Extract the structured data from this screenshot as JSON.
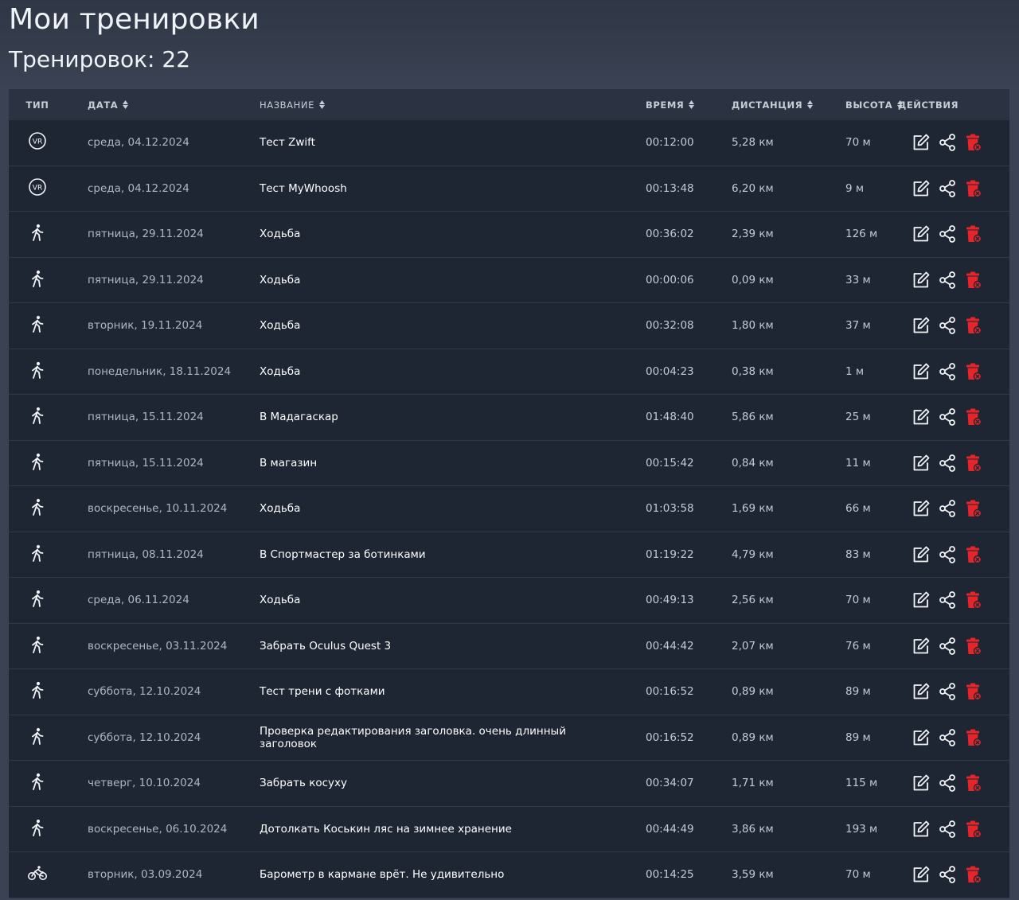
{
  "page": {
    "title": "Мои тренировки",
    "count_label": "Тренировок: 22"
  },
  "colors": {
    "delete": "#e5252a",
    "icon": "#f2f4f7"
  },
  "table": {
    "headers": {
      "type": "Тип",
      "date": "Дата",
      "name": "Название",
      "time": "Время",
      "distance": "Дистанция",
      "altitude": "Высота",
      "actions": "Действия"
    },
    "rows": [
      {
        "type": "vr-icon",
        "date": "среда, 04.12.2024",
        "name": "Тест Zwift",
        "time": "00:12:00",
        "distance": "5,28 км",
        "altitude": "70 м"
      },
      {
        "type": "vr-icon",
        "date": "среда, 04.12.2024",
        "name": "Тест MyWhoosh",
        "time": "00:13:48",
        "distance": "6,20 км",
        "altitude": "9 м"
      },
      {
        "type": "walk-icon",
        "date": "пятница, 29.11.2024",
        "name": "Ходьба",
        "time": "00:36:02",
        "distance": "2,39 км",
        "altitude": "126 м"
      },
      {
        "type": "walk-icon",
        "date": "пятница, 29.11.2024",
        "name": "Ходьба",
        "time": "00:00:06",
        "distance": "0,09 км",
        "altitude": "33 м"
      },
      {
        "type": "walk-icon",
        "date": "вторник, 19.11.2024",
        "name": "Ходьба",
        "time": "00:32:08",
        "distance": "1,80 км",
        "altitude": "37 м"
      },
      {
        "type": "walk-icon",
        "date": "понедельник, 18.11.2024",
        "name": "Ходьба",
        "time": "00:04:23",
        "distance": "0,38 км",
        "altitude": "1 м"
      },
      {
        "type": "walk-icon",
        "date": "пятница, 15.11.2024",
        "name": "В Мадагаскар",
        "time": "01:48:40",
        "distance": "5,86 км",
        "altitude": "25 м"
      },
      {
        "type": "walk-icon",
        "date": "пятница, 15.11.2024",
        "name": "В магазин",
        "time": "00:15:42",
        "distance": "0,84 км",
        "altitude": "11 м"
      },
      {
        "type": "walk-icon",
        "date": "воскресенье, 10.11.2024",
        "name": "Ходьба",
        "time": "01:03:58",
        "distance": "1,69 км",
        "altitude": "66 м"
      },
      {
        "type": "walk-icon",
        "date": "пятница, 08.11.2024",
        "name": "В Спортмастер за ботинками",
        "time": "01:19:22",
        "distance": "4,79 км",
        "altitude": "83 м"
      },
      {
        "type": "walk-icon",
        "date": "среда, 06.11.2024",
        "name": "Ходьба",
        "time": "00:49:13",
        "distance": "2,56 км",
        "altitude": "70 м"
      },
      {
        "type": "walk-icon",
        "date": "воскресенье, 03.11.2024",
        "name": "Забрать Oculus Quest 3",
        "time": "00:44:42",
        "distance": "2,07 км",
        "altitude": "76 м"
      },
      {
        "type": "walk-icon",
        "date": "суббота, 12.10.2024",
        "name": "Тест трени с фотками",
        "time": "00:16:52",
        "distance": "0,89 км",
        "altitude": "89 м"
      },
      {
        "type": "walk-icon",
        "date": "суббота, 12.10.2024",
        "name": "Проверка редактирования заголовка. очень длинный заголовок",
        "time": "00:16:52",
        "distance": "0,89 км",
        "altitude": "89 м"
      },
      {
        "type": "walk-icon",
        "date": "четверг, 10.10.2024",
        "name": "Забрать косуху",
        "time": "00:34:07",
        "distance": "1,71 км",
        "altitude": "115 м"
      },
      {
        "type": "walk-icon",
        "date": "воскресенье, 06.10.2024",
        "name": "Дотолкать Коськин ляс на зимнее хранение",
        "time": "00:44:49",
        "distance": "3,86 км",
        "altitude": "193 м"
      },
      {
        "type": "bike-icon",
        "date": "вторник, 03.09.2024",
        "name": "Барометр в кармане врёт. Не удивительно",
        "time": "00:14:25",
        "distance": "3,59 км",
        "altitude": "70 м"
      }
    ]
  }
}
